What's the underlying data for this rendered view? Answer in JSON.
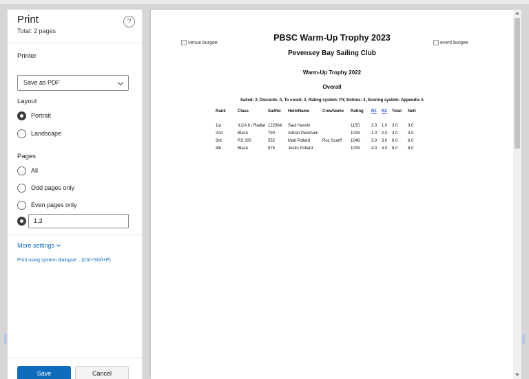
{
  "dialog": {
    "title": "Print",
    "total_pages": "Total: 2 pages",
    "help_label": "?"
  },
  "printer": {
    "section_label": "Printer",
    "selected": "Save as PDF"
  },
  "layout": {
    "section_label": "Layout",
    "options": [
      "Portrait",
      "Landscape"
    ],
    "selected": "Portrait"
  },
  "pages": {
    "section_label": "Pages",
    "options": [
      "All",
      "Odd pages only",
      "Even pages only"
    ],
    "custom_value": "1,3"
  },
  "more_settings": "More settings",
  "system_dialog_link": "Print using system dialogue... (Ctrl+Shift+P)",
  "buttons": {
    "save": "Save",
    "cancel": "Cancel"
  },
  "preview": {
    "venue_burgee": "venue burgee",
    "event_burgee": "event burgee",
    "title": "PBSC Warm-Up Trophy 2023",
    "club": "Pevensey Bay Sailing Club",
    "event": "Warm-Up Trophy 2022",
    "group": "Overall",
    "summary": "Sailed: 2, Discards: 0, To count: 2, Rating system: PY, Entries: 4, Scoring system: Appendix A",
    "columns": [
      "Rank",
      "Class",
      "SailNo",
      "HelmName",
      "CrewName",
      "Rating",
      "R1",
      "R2",
      "Total",
      "Nett"
    ],
    "rows": [
      [
        "1st",
        "ILCA 6 / Radial",
        "122364",
        "Saul Harwin",
        "",
        "1150",
        "2.0",
        "1.0",
        "3.0",
        "3.0"
      ],
      [
        "2nd",
        "Blaze",
        "790",
        "Adrian Peckham",
        "",
        "1033",
        "1.0",
        "2.0",
        "3.0",
        "3.0"
      ],
      [
        "3rd",
        "RS 200",
        "552",
        "Matt Pollard",
        "Roz Scarff",
        "1046",
        "3.0",
        "3.0",
        "6.0",
        "6.0"
      ],
      [
        "4th",
        "Blaze",
        "575",
        "Justin Pollard",
        "",
        "1033",
        "4.0",
        "4.0",
        "8.0",
        "8.0"
      ]
    ]
  },
  "colors": {
    "accent": "#0f6cbd",
    "race_link": "#1a4fd0"
  }
}
